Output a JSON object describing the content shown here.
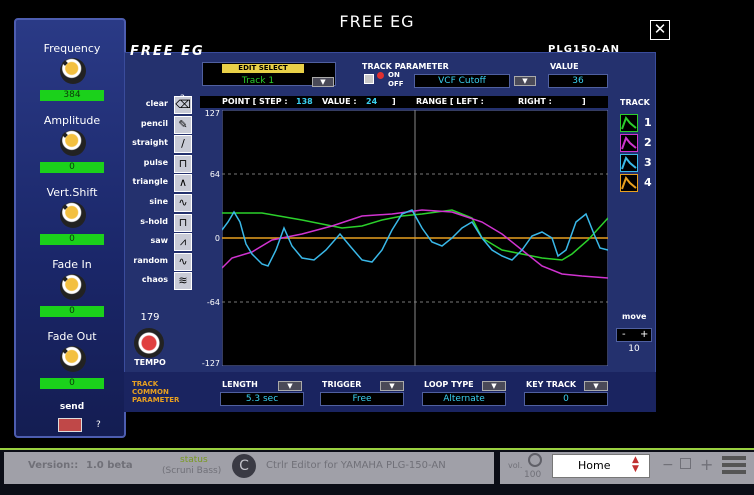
{
  "window": {
    "title": "FREE EG",
    "close_icon": "close-icon"
  },
  "sidebar": {
    "knobs": [
      {
        "label": "Frequency",
        "value": "384"
      },
      {
        "label": "Amplitude",
        "value": "0"
      },
      {
        "label": "Vert.Shift",
        "value": "0"
      },
      {
        "label": "Fade In",
        "value": "0"
      },
      {
        "label": "Fade Out",
        "value": "0"
      }
    ],
    "send_label": "send",
    "help": "?"
  },
  "panel": {
    "logo_left": "FREE EG",
    "logo_right": "PLG150-AN",
    "edit_select": {
      "label": "EDIT SELECT",
      "value": "Track 1"
    },
    "track_param": {
      "label": "TRACK PARAMETER",
      "on": "ON",
      "off": "OFF",
      "value": "VCF Cutoff"
    },
    "value": {
      "label": "VALUE",
      "value": "36"
    },
    "help": "?",
    "tempo": {
      "value": "179",
      "label": "TEMPO"
    }
  },
  "tools": [
    "clear",
    "pencil",
    "straight",
    "pulse",
    "triangle",
    "sine",
    "s-hold",
    "saw",
    "random",
    "chaos"
  ],
  "graph": {
    "point_label": "POINT [ STEP :",
    "step": "138",
    "value_label": "VALUE :",
    "value": "24",
    "close_bracket": "]",
    "range_label": "RANGE [ LEFT :",
    "right_label": "RIGHT :",
    "range_close": "]",
    "y_ticks": [
      "127",
      "64",
      "0",
      "-64",
      "-127"
    ],
    "colors": {
      "green": "#2bd02b",
      "magenta": "#d033d0",
      "cyan": "#3ab8e8",
      "orange": "#e8a020"
    }
  },
  "tracks": {
    "label": "TRACK",
    "items": [
      "1",
      "2",
      "3",
      "4"
    ],
    "move": "move",
    "minus": "-",
    "plus": "+",
    "move_value": "10"
  },
  "common": {
    "title": "TRACK COMMON PARAMETER",
    "length": {
      "label": "LENGTH",
      "value": "5.3 sec"
    },
    "trigger": {
      "label": "TRIGGER",
      "value": "Free"
    },
    "loop": {
      "label": "LOOP TYPE",
      "value": "Alternate"
    },
    "key": {
      "label": "KEY TRACK",
      "value": "0"
    }
  },
  "statusbar": {
    "version_label": "Version::",
    "version": "1.0 beta",
    "status_label": "status",
    "status_value": "(Scruni Bass)",
    "editor": "Ctrlr Editor for YAMAHA PLG-150-AN",
    "vol_label": "vol.",
    "vol_value": "100",
    "page": "Home"
  }
}
